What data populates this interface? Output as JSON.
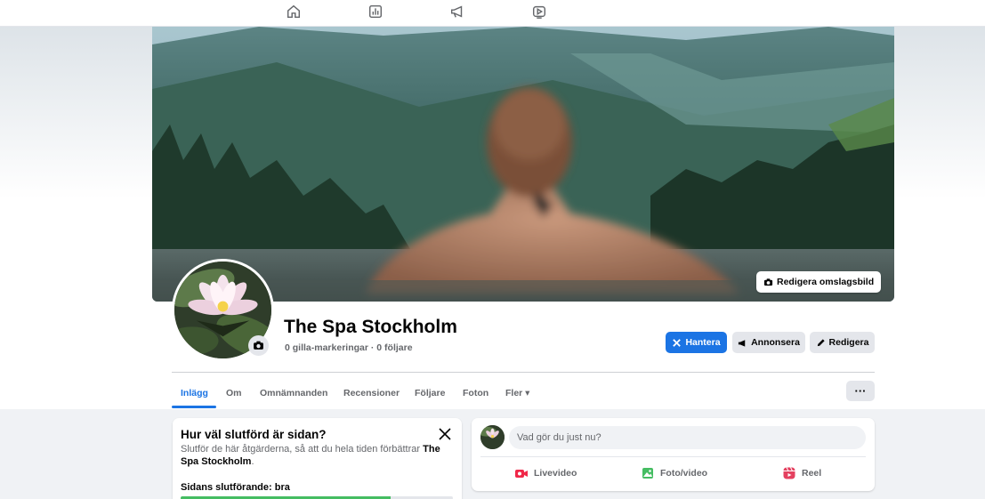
{
  "topnav": {
    "icons": [
      "home-icon",
      "insights-icon",
      "megaphone-icon",
      "video-icon"
    ]
  },
  "cover": {
    "edit_button_label": "Redigera omslagsbild"
  },
  "page": {
    "name": "The Spa Stockholm",
    "stats": "0 gilla-markeringar · 0 följare"
  },
  "actions": {
    "manage_label": "Hantera",
    "advertise_label": "Annonsera",
    "edit_label": "Redigera"
  },
  "tabs": [
    {
      "label": "Inlägg",
      "active": true
    },
    {
      "label": "Om"
    },
    {
      "label": "Omnämnanden"
    },
    {
      "label": "Recensioner"
    },
    {
      "label": "Följare"
    },
    {
      "label": "Foton"
    },
    {
      "label": "Fler ▾"
    }
  ],
  "more_button_label": "···",
  "completion_card": {
    "title": "Hur väl slutförd är sidan?",
    "description_prefix": "Slutför de här åtgärderna, så att du hela tiden förbättrar ",
    "description_bold": "The Spa Stockholm",
    "description_suffix": ".",
    "progress_label": "Sidans slutförande: bra",
    "progress_fraction": 0.77
  },
  "composer": {
    "placeholder": "Vad gör du just nu?",
    "live_label": "Livevideo",
    "photo_label": "Foto/video",
    "reel_label": "Reel"
  },
  "colors": {
    "accent": "#1b74e4",
    "progress": "#45bd62",
    "live": "#f02849",
    "photo": "#45bd62",
    "reel": "#e4405f"
  }
}
